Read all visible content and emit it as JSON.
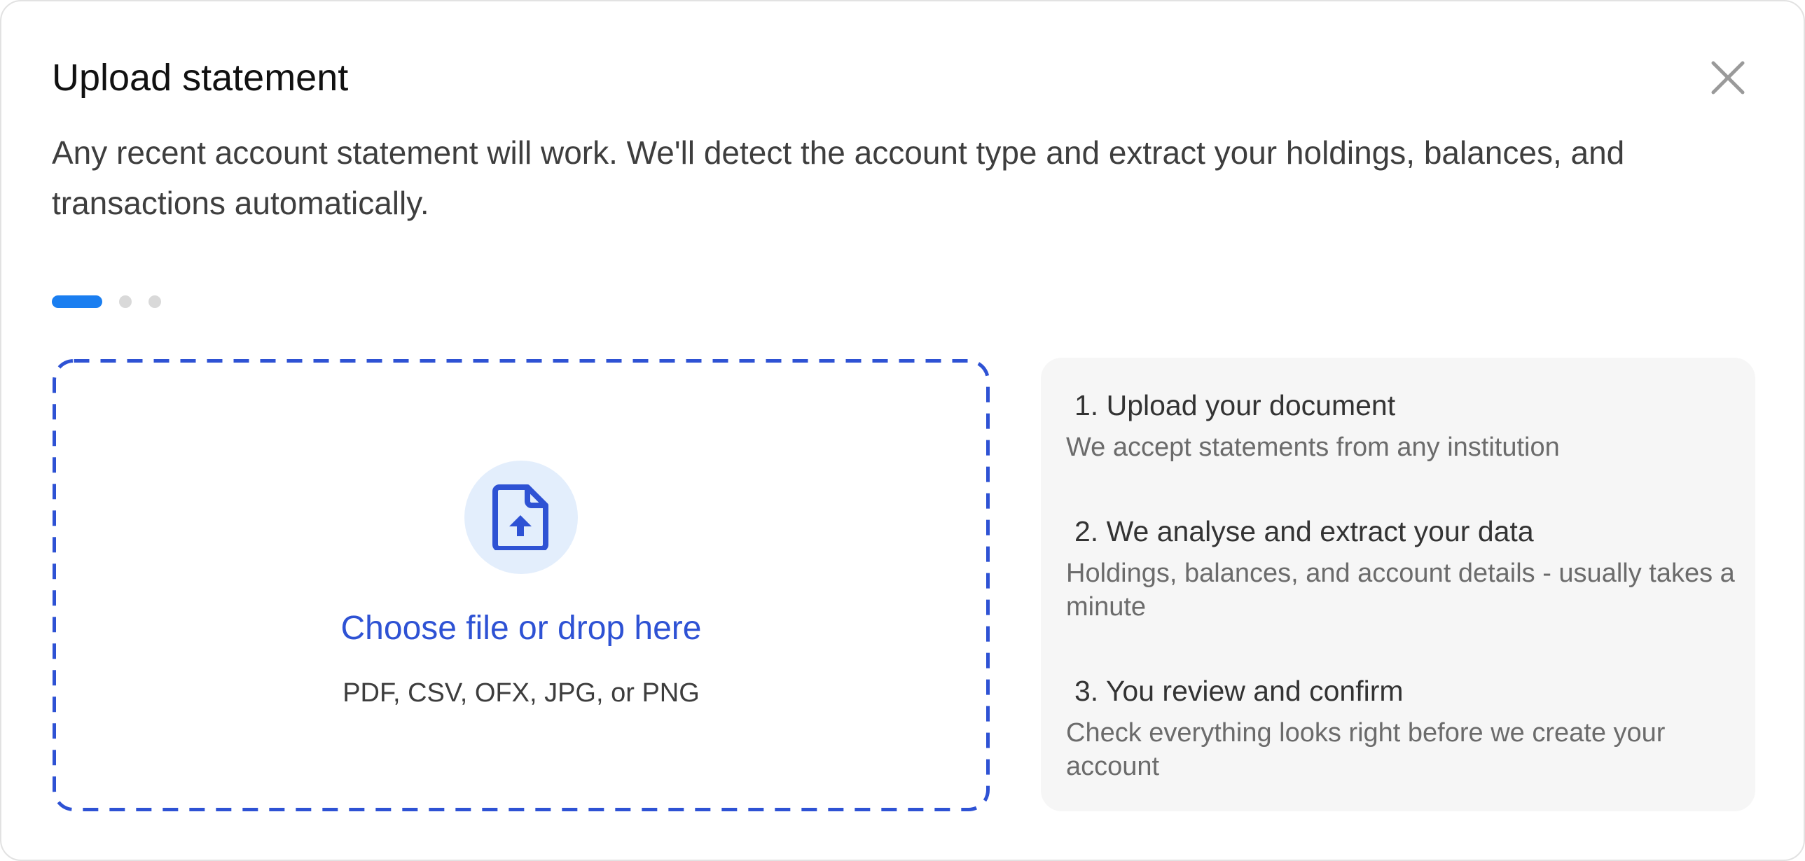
{
  "dialog": {
    "title": "Upload statement",
    "close_icon": "close-icon",
    "description": "Any recent account statement will work. We'll detect the account type and extract your holdings, balances, and transactions automatically."
  },
  "progress": {
    "current_step": 1,
    "total_steps": 3,
    "active_color": "#1a7ef0",
    "inactive_color": "#d9d9d9"
  },
  "dropzone": {
    "icon": "file-upload-icon",
    "label": "Choose file or drop here",
    "formats": "PDF, CSV, OFX, JPG, or PNG",
    "accent_color": "#2e52d4"
  },
  "steps": [
    {
      "title": "1. Upload your document",
      "description": "We accept statements from any institution"
    },
    {
      "title": "2. We analyse and extract your data",
      "description": "Holdings, balances, and account details - usually takes a minute"
    },
    {
      "title": "3. You review and confirm",
      "description": "Check everything looks right before we create your account"
    }
  ]
}
